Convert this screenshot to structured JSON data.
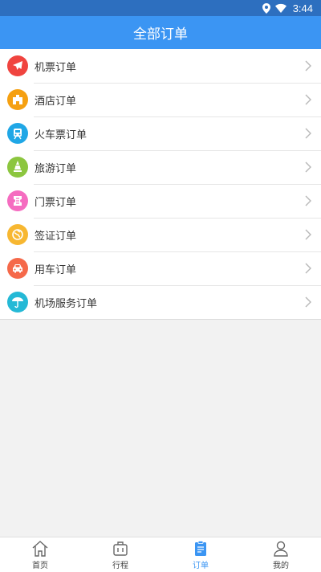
{
  "status_bar": {
    "time": "3:44"
  },
  "header": {
    "title": "全部订单"
  },
  "orders": [
    {
      "label": "机票订单",
      "icon": "airplane-icon",
      "color": "#f0443f"
    },
    {
      "label": "酒店订单",
      "icon": "hotel-icon",
      "color": "#f5a011"
    },
    {
      "label": "火车票订单",
      "icon": "train-icon",
      "color": "#20a7e6"
    },
    {
      "label": "旅游订单",
      "icon": "travel-icon",
      "color": "#8cc63f"
    },
    {
      "label": "门票订单",
      "icon": "ticket-icon",
      "color": "#f56cc0"
    },
    {
      "label": "签证订单",
      "icon": "visa-icon",
      "color": "#f7b731"
    },
    {
      "label": "用车订单",
      "icon": "car-icon",
      "color": "#f5694a"
    },
    {
      "label": "机场服务订单",
      "icon": "airport-service-icon",
      "color": "#25b9d6"
    }
  ],
  "tabs": [
    {
      "label": "首页",
      "icon": "home-icon"
    },
    {
      "label": "行程",
      "icon": "suitcase-icon"
    },
    {
      "label": "订单",
      "icon": "order-icon",
      "active": true
    },
    {
      "label": "我的",
      "icon": "profile-icon"
    }
  ],
  "colors": {
    "primary": "#3b95f3",
    "status_bar": "#2d6fbf",
    "background": "#f2f2f2"
  }
}
